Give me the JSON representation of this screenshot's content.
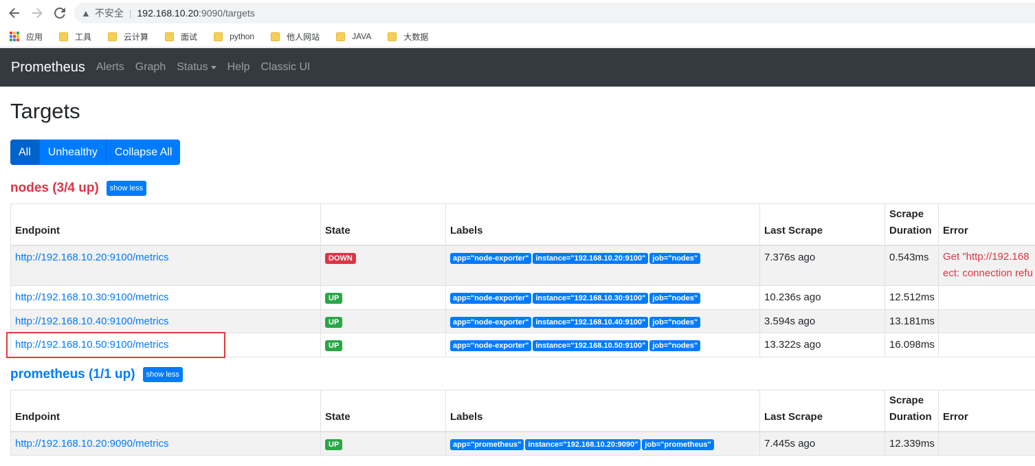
{
  "browser": {
    "insecure_label": "不安全",
    "url_host": "192.168.10.20",
    "url_path": ":9090/targets",
    "bookmarks": [
      "应用",
      "工具",
      "云计算",
      "面试",
      "python",
      "他人网站",
      "JAVA",
      "大数据"
    ]
  },
  "navbar": {
    "brand": "Prometheus",
    "links": [
      "Alerts",
      "Graph",
      "Status",
      "Help",
      "Classic UI"
    ]
  },
  "page": {
    "title": "Targets",
    "filter_buttons": [
      "All",
      "Unhealthy",
      "Collapse All"
    ]
  },
  "columns": {
    "endpoint": "Endpoint",
    "state": "State",
    "labels": "Labels",
    "last_scrape": "Last Scrape",
    "scrape_duration_1": "Scrape",
    "scrape_duration_2": "Duration",
    "error": "Error"
  },
  "pools": [
    {
      "name": "nodes (3/4 up)",
      "color": "#dc3545",
      "toggle": "show less",
      "rows": [
        {
          "endpoint": "http://192.168.10.20:9100/metrics",
          "state": "DOWN",
          "labels": [
            "app=\"node-exporter\"",
            "instance=\"192.168.10.20:9100\"",
            "job=\"nodes\""
          ],
          "last_scrape": "7.376s ago",
          "duration": "0.543ms",
          "error_1": "Get \"http://192.168",
          "error_2": "ect: connection refu"
        },
        {
          "endpoint": "http://192.168.10.30:9100/metrics",
          "state": "UP",
          "labels": [
            "app=\"node-exporter\"",
            "instance=\"192.168.10.30:9100\"",
            "job=\"nodes\""
          ],
          "last_scrape": "10.236s ago",
          "duration": "12.512ms",
          "error_1": "",
          "error_2": ""
        },
        {
          "endpoint": "http://192.168.10.40:9100/metrics",
          "state": "UP",
          "labels": [
            "app=\"node-exporter\"",
            "instance=\"192.168.10.40:9100\"",
            "job=\"nodes\""
          ],
          "last_scrape": "3.594s ago",
          "duration": "13.181ms",
          "error_1": "",
          "error_2": ""
        },
        {
          "endpoint": "http://192.168.10.50:9100/metrics",
          "state": "UP",
          "labels": [
            "app=\"node-exporter\"",
            "instance=\"192.168.10.50:9100\"",
            "job=\"nodes\""
          ],
          "last_scrape": "13.322s ago",
          "duration": "16.098ms",
          "error_1": "",
          "error_2": ""
        }
      ]
    },
    {
      "name": "prometheus (1/1 up)",
      "color": "#007bff",
      "toggle": "show less",
      "rows": [
        {
          "endpoint": "http://192.168.10.20:9090/metrics",
          "state": "UP",
          "labels": [
            "app=\"prometheus\"",
            "instance=\"192.168.10.20:9090\"",
            "job=\"prometheus\""
          ],
          "last_scrape": "7.445s ago",
          "duration": "12.339ms",
          "error_1": "",
          "error_2": ""
        }
      ]
    }
  ]
}
